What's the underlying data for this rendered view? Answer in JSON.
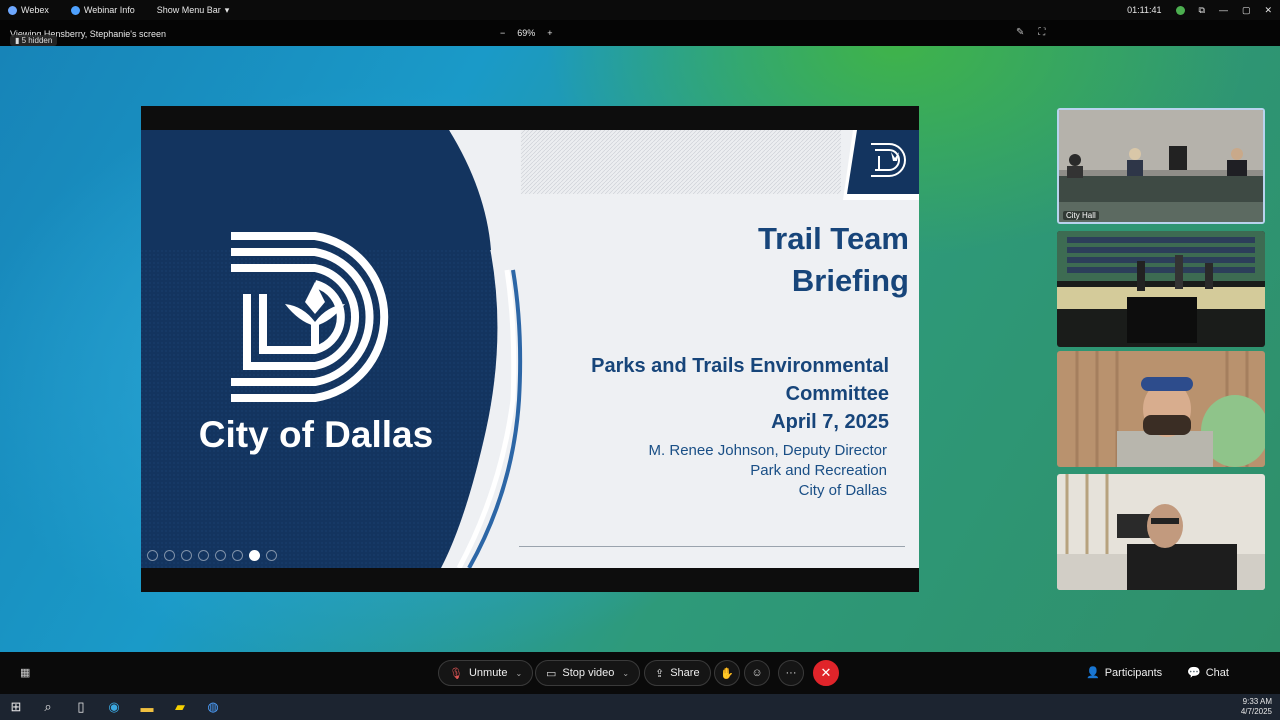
{
  "topbar": {
    "app_name": "Webex",
    "webinar_info": "Webinar Info",
    "show_menu_bar": "Show Menu Bar",
    "chevron": "▾",
    "elapsed_time": "01:11:41"
  },
  "subbar": {
    "viewing": "Viewing Hensberry, Stephanie's screen",
    "hidden_count": "5 hidden",
    "zoom_out": "−",
    "zoom_level": "69%",
    "zoom_in": "+"
  },
  "slide": {
    "city_name": "City of Dallas",
    "title_line1": "Trail Team",
    "title_line2": "Briefing",
    "subtitle_line1": "Parks and Trails Environmental",
    "subtitle_line2": "Committee",
    "date": "April 7, 2025",
    "presenter_name": "M. Renee Johnson, Deputy Director",
    "department": "Park and Recreation",
    "organization": "City of Dallas"
  },
  "tiles": [
    {
      "label": "City Hall"
    }
  ],
  "controls": {
    "unmute": "Unmute",
    "stop_video": "Stop video",
    "share": "Share",
    "more": "···",
    "leave": "✕",
    "participants": "Participants",
    "chat": "Chat",
    "chevron": "⌄"
  },
  "taskbar": {
    "time": "9:33 AM",
    "date": "4/7/2025"
  },
  "colors": {
    "slide_navy": "#17457a",
    "leave_red": "#e0242a"
  }
}
